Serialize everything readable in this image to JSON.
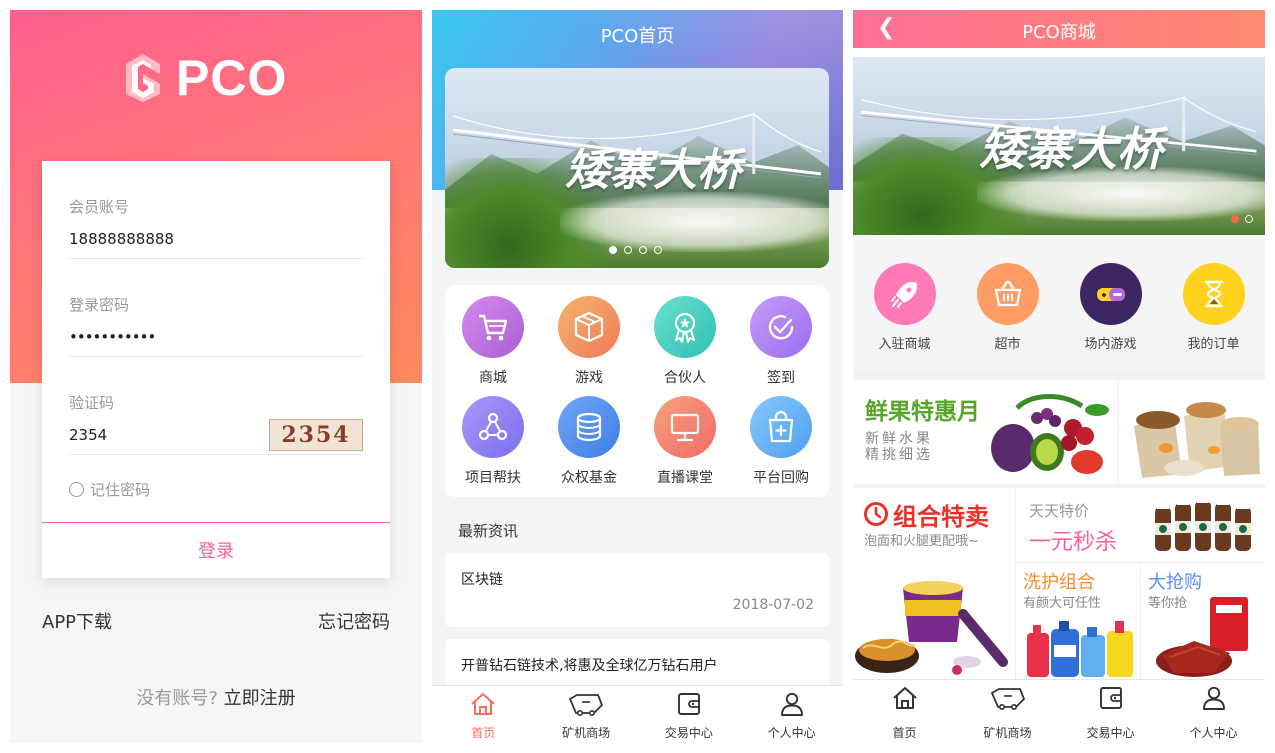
{
  "login": {
    "logo_text": "PCO",
    "account_label": "会员账号",
    "account_value": "18888888888",
    "password_label": "登录密码",
    "password_value": "•••••••••••",
    "captcha_label": "验证码",
    "captcha_value": "2354",
    "captcha_image_text": "2354",
    "remember_label": "记住密码",
    "login_button": "登录",
    "app_download": "APP下载",
    "forgot_password": "忘记密码",
    "no_account": "没有账号?",
    "register": "立即注册",
    "accent_color": "#ff5f9a"
  },
  "home": {
    "title": "PCO首页",
    "banner_caption": "矮寨大桥",
    "banner_dots": 4,
    "banner_active_dot": 1,
    "grid": [
      {
        "label": "商城",
        "icon": "cart-icon",
        "color": "#c06fd6"
      },
      {
        "label": "游戏",
        "icon": "box-icon",
        "color": "#f39a5e"
      },
      {
        "label": "合伙人",
        "icon": "award-icon",
        "color": "#4fd1c0"
      },
      {
        "label": "签到",
        "icon": "check-circle-icon",
        "color": "#b27ef0"
      },
      {
        "label": "项目帮扶",
        "icon": "share-nodes-icon",
        "color": "#8a7ff0"
      },
      {
        "label": "众权基金",
        "icon": "coins-icon",
        "color": "#4f8ef0"
      },
      {
        "label": "直播课堂",
        "icon": "monitor-icon",
        "color": "#f27a6a"
      },
      {
        "label": "平台回购",
        "icon": "bag-plus-icon",
        "color": "#5ab0f5"
      }
    ],
    "news_heading": "最新资讯",
    "news": [
      {
        "title": "区块链",
        "date": "2018-07-02"
      },
      {
        "title": "开普钻石链技术,将惠及全球亿万钻石用户",
        "date": ""
      }
    ]
  },
  "tabbar": [
    {
      "label": "首页",
      "icon": "home-icon"
    },
    {
      "label": "矿机商场",
      "icon": "mining-cart-icon"
    },
    {
      "label": "交易中心",
      "icon": "wallet-icon"
    },
    {
      "label": "个人中心",
      "icon": "person-icon"
    }
  ],
  "home_active_tab": "首页",
  "mall": {
    "title": "PCO商城",
    "back_icon": "chevron-left-icon",
    "banner_caption": "矮寨大桥",
    "categories": [
      {
        "label": "入驻商城",
        "icon": "rocket-icon",
        "color": "#ff6fa8"
      },
      {
        "label": "超市",
        "icon": "basket-icon",
        "color": "#ff9966"
      },
      {
        "label": "场内游戏",
        "icon": "gamepad-icon",
        "color": "#3a2460"
      },
      {
        "label": "我的订单",
        "icon": "hourglass-icon",
        "color": "#ffd21e"
      }
    ],
    "promos": {
      "fruit_title": "鲜果特惠月",
      "fruit_sub1": "新鲜水果",
      "fruit_sub2": "精挑细选",
      "combo_title": "组合特卖",
      "combo_sub": "泡面和火腿更配哦~",
      "daily_title": "天天特价",
      "daily_sub": "一元秒杀",
      "wash_title": "洗护组合",
      "wash_sub": "有颜大可任性",
      "rush_title": "大抢购",
      "rush_sub": "等你抢"
    }
  }
}
